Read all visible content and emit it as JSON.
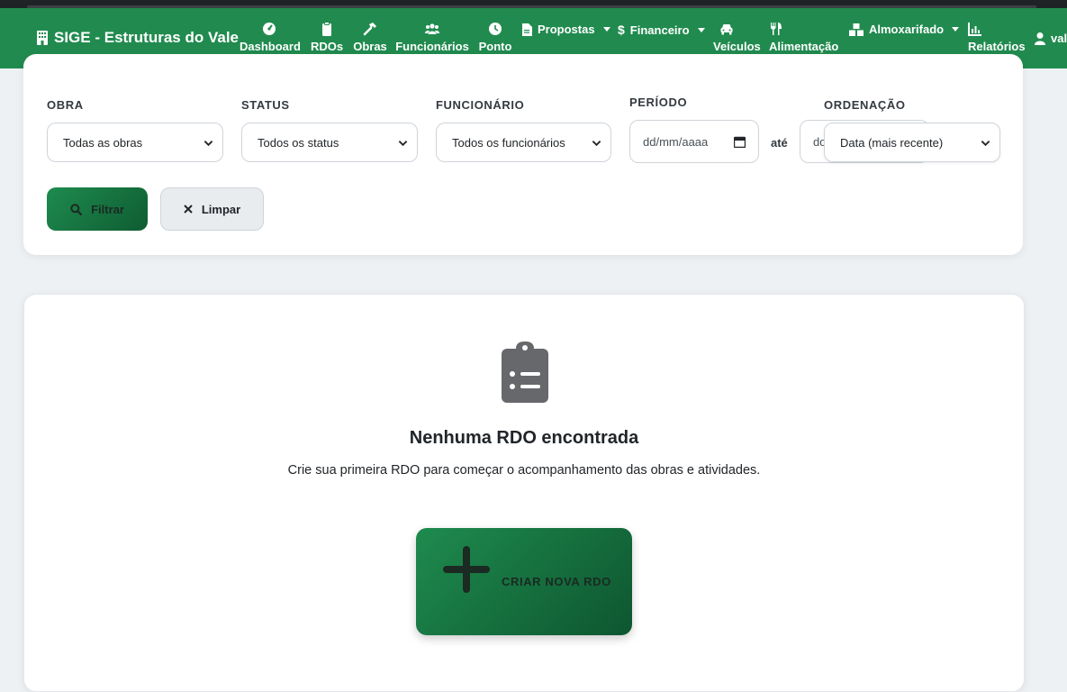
{
  "navbar": {
    "brand": "SIGE - Estruturas do Vale",
    "items": {
      "dashboard": "Dashboard",
      "rdos": "RDOs",
      "obras": "Obras",
      "funcionarios": "Funcionários",
      "ponto": "Ponto",
      "propostas": "Propostas",
      "financeiro": "Financeiro",
      "veiculos": "Veículos",
      "alimentacao": "Alimentação",
      "almoxarifado": "Almoxarifado",
      "relatorios": "Relatórios",
      "user": "val"
    },
    "color": "#218b4f"
  },
  "filters": {
    "obra_label": "OBRA",
    "obra_value": "Todas as obras",
    "status_label": "STATUS",
    "status_value": "Todos os status",
    "funcionario_label": "FUNCIONÁRIO",
    "funcionario_value": "Todos os funcionários",
    "periodo_label": "PERÍODO",
    "date_from": "dd/mm/aaaa",
    "ate": "até",
    "date_to": "dd",
    "ordenacao_label": "ORDENAÇÃO",
    "ordenacao_value": "Data (mais recente)",
    "filter_button": "Filtrar",
    "clear_button": "Limpar"
  },
  "empty_state": {
    "title": "Nenhuma RDO encontrada",
    "subtitle": "Crie sua primeira RDO para começar o acompanhamento das obras e atividades.",
    "create_button": "CRIAR NOVA RDO",
    "icon": "clipboard-list-icon"
  }
}
